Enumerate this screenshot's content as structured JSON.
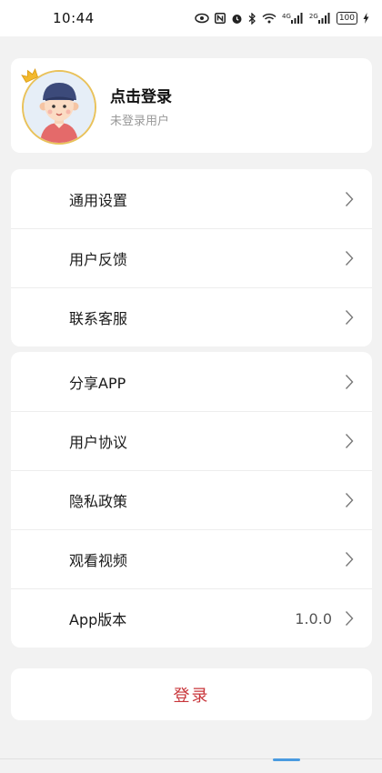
{
  "status_bar": {
    "time": "10:44",
    "net_4g": "4G",
    "net_2g": "2G",
    "battery": "100"
  },
  "profile": {
    "title": "点击登录",
    "subtitle": "未登录用户"
  },
  "group1": [
    {
      "label": "通用设置"
    },
    {
      "label": "用户反馈"
    },
    {
      "label": "联系客服"
    }
  ],
  "group2": [
    {
      "label": "分享APP"
    },
    {
      "label": "用户协议"
    },
    {
      "label": "隐私政策"
    },
    {
      "label": "观看视频"
    },
    {
      "label": "App版本",
      "value": "1.0.0"
    }
  ],
  "login_button": "登录",
  "colors": {
    "accent_red": "#c8353a",
    "avatar_border": "#e9c25b",
    "background": "#f2f2f2"
  }
}
